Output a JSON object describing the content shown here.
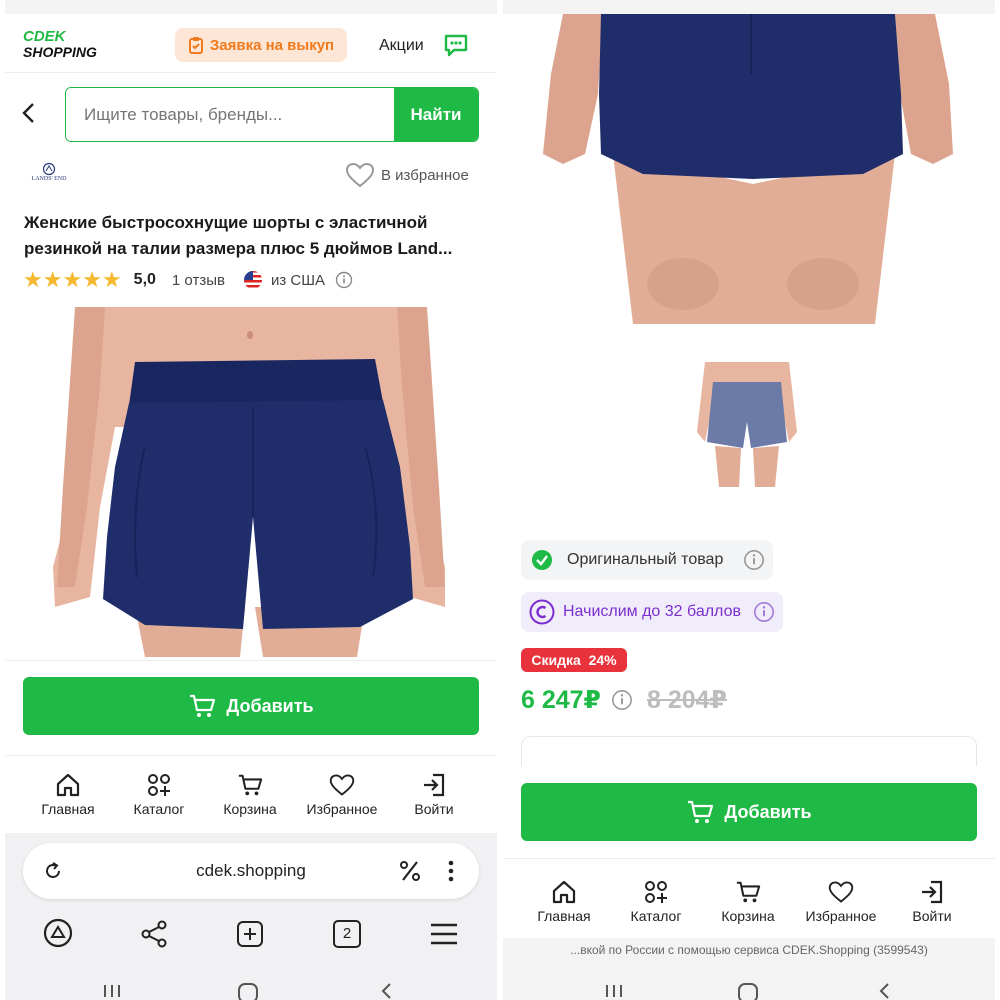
{
  "left": {
    "logo_line1": "CDEK",
    "logo_line2": "SHOPPING",
    "buyout_button": "Заявка на выкуп",
    "promo_link": "Акции",
    "search_placeholder": "Ищите товары, бренды...",
    "search_button": "Найти",
    "brand_logo_text": "LANDS' END",
    "favorite_label": "В избранное",
    "title_line1": "Женские быстросохнущие шорты с эластичной",
    "title_line2": "резинкой на талии размера плюс 5 дюймов Land...",
    "rating_value": "5,0",
    "reviews": "1 отзыв",
    "origin": "из США",
    "add_button": "Добавить",
    "nav": [
      {
        "label": "Главная",
        "icon": "home-icon"
      },
      {
        "label": "Каталог",
        "icon": "catalog-icon"
      },
      {
        "label": "Корзина",
        "icon": "cart-icon"
      },
      {
        "label": "Избранное",
        "icon": "heart-icon"
      },
      {
        "label": "Войти",
        "icon": "login-icon"
      }
    ],
    "browser_url": "cdek.shopping",
    "tab_count": "2"
  },
  "right": {
    "badge_original": "Оригинальный товар",
    "badge_points": "Начислим до 32 баллов",
    "discount": "Скидка  24%",
    "price": "6 247₽",
    "old_price": "8 204₽",
    "add_button": "Добавить",
    "nav": [
      {
        "label": "Главная",
        "icon": "home-icon"
      },
      {
        "label": "Каталог",
        "icon": "catalog-icon"
      },
      {
        "label": "Корзина",
        "icon": "cart-icon"
      },
      {
        "label": "Избранное",
        "icon": "heart-icon"
      },
      {
        "label": "Войти",
        "icon": "login-icon"
      }
    ],
    "footer_text": "...вкой по России с помощью сервиса CDEK.Shopping (3599543)"
  },
  "colors": {
    "accent_green": "#1fba45",
    "discount_red": "#e8323c",
    "price_green": "#1fba45",
    "points_purple": "#7b2fd0",
    "shorts_navy": "#1f2d6b"
  }
}
